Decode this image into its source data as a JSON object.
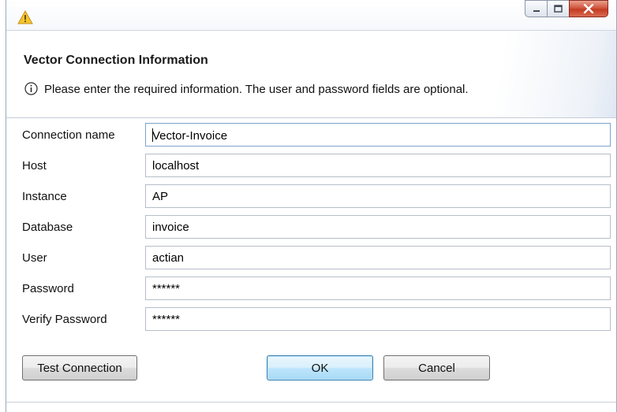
{
  "window": {
    "icon": "warning-triangle-icon",
    "controls": {
      "minimize_icon": "minimize-icon",
      "maximize_icon": "maximize-icon",
      "close_icon": "close-icon"
    }
  },
  "header": {
    "title": "Vector Connection Information",
    "info_icon": "info-icon",
    "message": "Please enter the required information. The user and password fields are optional."
  },
  "form": {
    "connection_name": {
      "label": "Connection name",
      "value": "Vector-Invoice"
    },
    "host": {
      "label": "Host",
      "value": "localhost"
    },
    "instance": {
      "label": "Instance",
      "value": "AP"
    },
    "database": {
      "label": "Database",
      "value": "invoice"
    },
    "user": {
      "label": "User",
      "value": "actian"
    },
    "password": {
      "label": "Password",
      "value": "******"
    },
    "verify_password": {
      "label": "Verify Password",
      "value": "******"
    }
  },
  "buttons": {
    "test_connection": "Test Connection",
    "ok": "OK",
    "cancel": "Cancel"
  },
  "colors": {
    "close_button": "#c43a22",
    "default_button_border": "#3c7fb1",
    "focused_field_border": "#7da2ce"
  }
}
